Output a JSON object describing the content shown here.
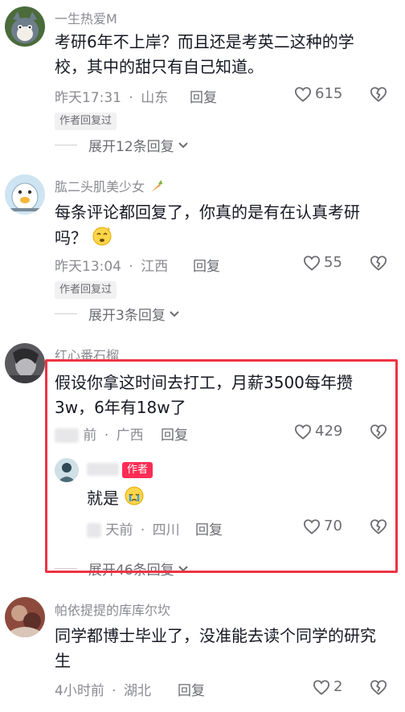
{
  "comments": [
    {
      "username": "一生热爱M",
      "text": "考研6年不上岸？而且还是考英二这种的学校，其中的甜只有自己知道。",
      "time": "昨天17:31",
      "location": "山东",
      "reply_label": "回复",
      "likes": "615",
      "author_replied": "作者回复过",
      "expand": "展开12条回复"
    },
    {
      "username": "肱二头肌美少女",
      "text": "每条评论都回复了，你真的是有在认真考研吗？",
      "time": "昨天13:04",
      "location": "江西",
      "reply_label": "回复",
      "likes": "55",
      "author_replied": "作者回复过",
      "expand": "展开3条回复"
    },
    {
      "username": "红心番石榴",
      "text": "假设你拿这时间去打工，月薪3500每年攒3w，6年有18w了",
      "time": "前",
      "location": "广西",
      "reply_label": "回复",
      "likes": "429",
      "expand": "展开46条回复"
    },
    {
      "username": "帕依提提的库库尔坎",
      "text": "同学都博士毕业了，没准能去读个同学的研究生",
      "time": "4小时前",
      "location": "湖北",
      "reply_label": "回复",
      "likes": "2"
    }
  ],
  "author_reply": {
    "badge": "作者",
    "text": "就是",
    "time": "天前",
    "location": "四川",
    "reply_label": "回复",
    "likes": "70"
  },
  "separator": "·"
}
